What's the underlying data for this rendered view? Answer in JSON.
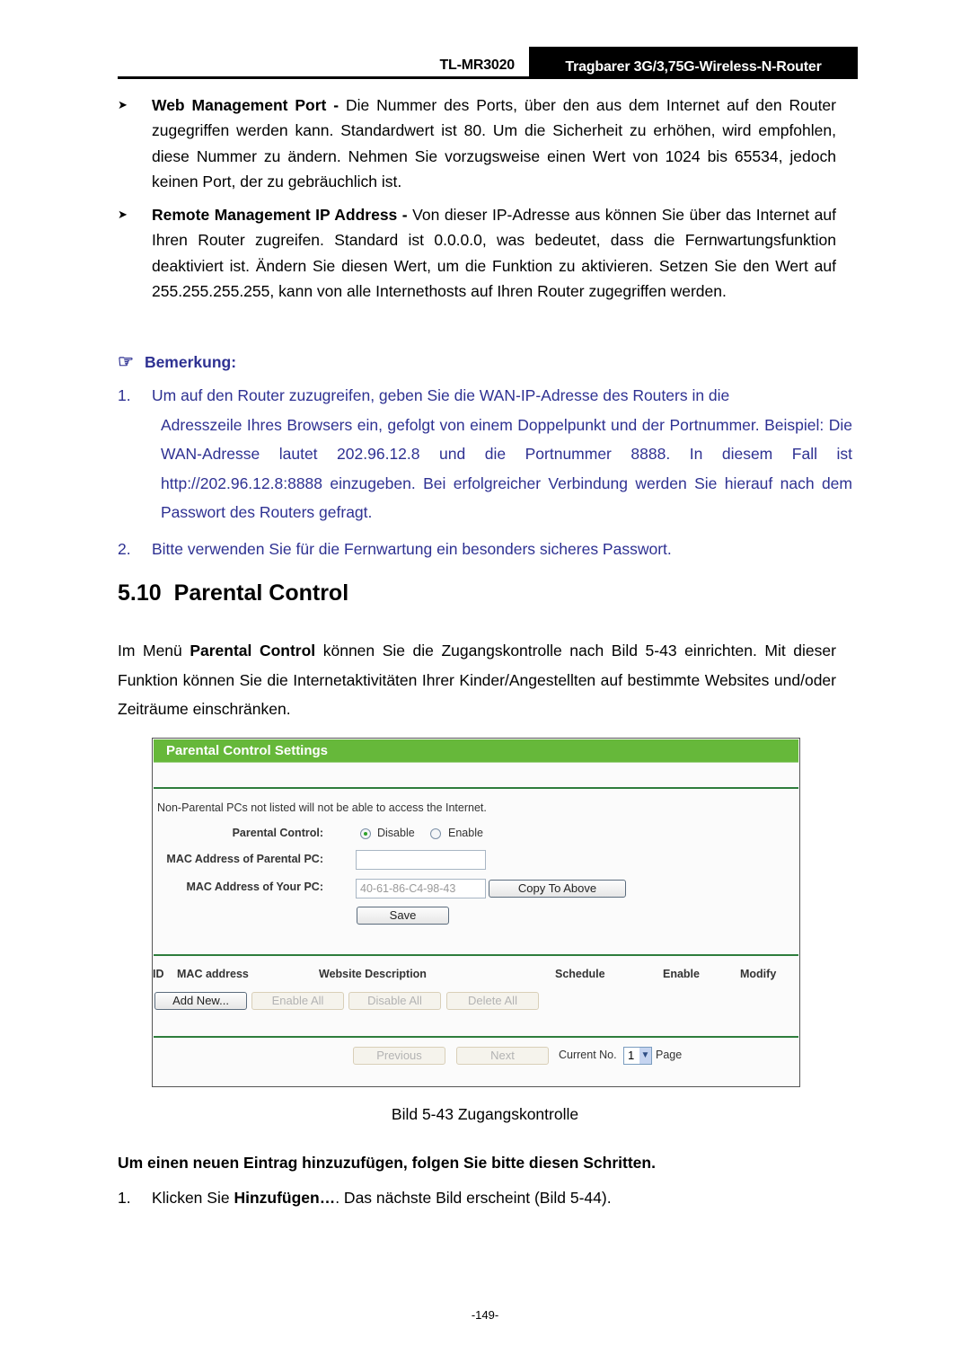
{
  "header": {
    "model": "TL-MR3020",
    "product_title": "Tragbarer 3G/3,75G-Wireless-N-Router"
  },
  "bullets": [
    {
      "term": "Web Management Port -",
      "text": " Die Nummer des Ports, über den aus dem Internet auf den Router zugegriffen werden kann. Standardwert ist 80. Um die Sicherheit zu erhöhen, wird empfohlen, diese Nummer zu ändern. Nehmen Sie vorzugsweise einen Wert von 1024 bis 65534, jedoch keinen Port, der zu gebräuchlich ist."
    },
    {
      "term": "Remote Management IP Address -",
      "text": " Von dieser IP-Adresse aus können Sie über das Internet auf Ihren Router zugreifen. Standard ist 0.0.0.0, was bedeutet, dass die Fernwartungsfunktion deaktiviert ist. Ändern Sie diesen Wert, um die Funktion zu aktivieren. Setzen Sie den Wert auf 255.255.255.255, kann von alle Internethosts auf Ihren Router zugegriffen werden."
    }
  ],
  "note": {
    "title": "Bemerkung:",
    "items": [
      {
        "num": "1.",
        "first_line": "Um auf den Router zuzugreifen, geben Sie die WAN-IP-Adresse des Routers in die",
        "rest": "Adresszeile Ihres Browsers ein, gefolgt von einem Doppelpunkt und der Portnummer. Beispiel: Die WAN-Adresse lautet 202.96.12.8 und die Portnummer 8888. In diesem Fall ist http://202.96.12.8:8888 einzugeben. Bei erfolgreicher Verbindung werden Sie hierauf nach dem Passwort des Routers gefragt."
      },
      {
        "num": "2.",
        "first_line": "Bitte verwenden Sie für die Fernwartung ein besonders sicheres Passwort.",
        "rest": ""
      }
    ]
  },
  "section": {
    "number": "5.10",
    "title": "Parental Control",
    "intro_pre": "Im Menü ",
    "intro_bold": "Parental Control",
    "intro_post": " können Sie die Zugangskontrolle nach Bild 5-43 einrichten. Mit dieser Funktion können Sie die Internetaktivitäten Ihrer Kinder/Angestellten auf bestimmte Websites und/oder Zeiträume einschränken."
  },
  "router_ui": {
    "panel_title": "Parental Control Settings",
    "notice": "Non-Parental PCs not listed will not be able to access the Internet.",
    "parental_control_label": "Parental Control:",
    "radio_disable": "Disable",
    "radio_enable": "Enable",
    "selected": "Disable",
    "mac_parental_label": "MAC Address of Parental PC:",
    "mac_parental_value": "",
    "mac_your_label": "MAC Address of Your PC:",
    "mac_your_value": "40-61-86-C4-98-43",
    "copy_button": "Copy To Above",
    "save_button": "Save",
    "columns": [
      "ID",
      "MAC address",
      "Website Description",
      "Schedule",
      "Enable",
      "Modify"
    ],
    "add_new_button": "Add New...",
    "enable_all_button": "Enable All",
    "disable_all_button": "Disable All",
    "delete_all_button": "Delete All",
    "previous_button": "Previous",
    "next_button": "Next",
    "current_no_label": "Current No.",
    "current_page": "1",
    "page_label": "Page",
    "colors": {
      "header_green": "#66b83a",
      "divider_green": "#2e7d3c"
    }
  },
  "caption": "Bild 5-43 Zugangskontrolle",
  "steps": {
    "title": "Um einen neuen Eintrag hinzuzufügen, folgen Sie bitte diesen Schritten.",
    "items": [
      {
        "num": "1.",
        "pre": "Klicken Sie ",
        "bold": "Hinzufügen…",
        "post": ". Das nächste Bild erscheint (Bild 5-44)."
      }
    ]
  },
  "page_number": "-149-",
  "colors": {
    "note_blue": "#2e3192"
  }
}
